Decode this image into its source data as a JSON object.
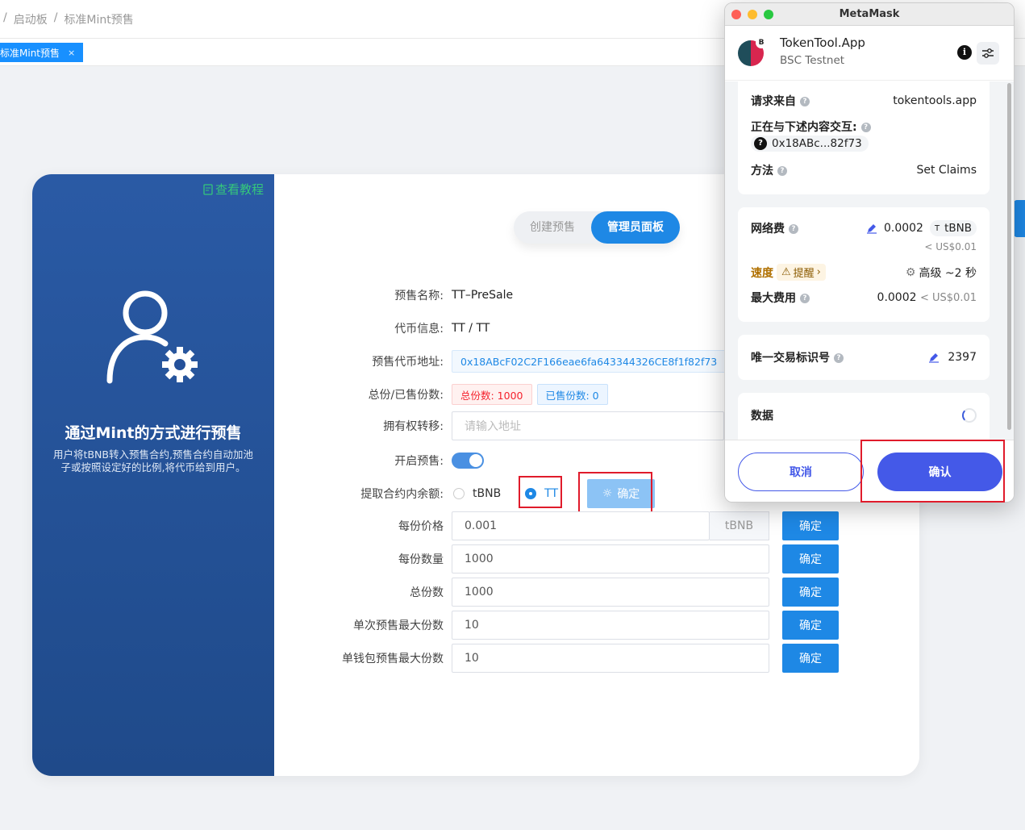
{
  "breadcrumb": {
    "sep1": "/",
    "item1": "启动板",
    "sep2": "/",
    "item2": "标准Mint预售"
  },
  "tabs": {
    "active_label": "标准Mint预售",
    "close": "×"
  },
  "left_panel": {
    "tutorial": "查看教程",
    "title": "通过Mint的方式进行预售",
    "desc": "用户将tBNB转入预售合约,预售合约自动加池子或按照设定好的比例,将代币给到用户。"
  },
  "segment": {
    "create": "创建预售",
    "admin": "管理员面板"
  },
  "form": {
    "presale_name": {
      "label": "预售名称:",
      "value": "TT–PreSale"
    },
    "token_info": {
      "label": "代币信息:",
      "value": "TT / TT"
    },
    "token_address": {
      "label": "预售代币地址:",
      "value": "0x18ABcF02C2F166eae6fa643344326CE8f1f82f73"
    },
    "shares": {
      "label": "总份/已售份数:",
      "total": "总份数: 1000",
      "sold": "已售份数: 0"
    },
    "ownership": {
      "label": "拥有权转移:",
      "placeholder": "请输入地址"
    },
    "open_presale": {
      "label": "开启预售:"
    },
    "withdraw": {
      "label": "提取合约内余额:",
      "opt1": "tBNB",
      "opt2": "TT",
      "button": "确定"
    },
    "price": {
      "label": "每份价格",
      "value": "0.001",
      "suffix": "tBNB",
      "button": "确定"
    },
    "qty": {
      "label": "每份数量",
      "value": "1000",
      "button": "确定"
    },
    "total": {
      "label": "总份数",
      "value": "1000",
      "button": "确定"
    },
    "max_single": {
      "label": "单次预售最大份数",
      "value": "10",
      "button": "确定"
    },
    "max_wallet": {
      "label": "单钱包预售最大份数",
      "value": "10",
      "button": "确定"
    }
  },
  "metamask": {
    "window_title": "MetaMask",
    "site_name": "TokenTool.App",
    "network": "BSC Testnet",
    "network_badge": "B",
    "request_from_label": "请求来自",
    "request_from_value": "tokentools.app",
    "interacting_label": "正在与下述内容交互:",
    "contract": "0x18ABc...82f73",
    "method_label": "方法",
    "method_value": "Set Claims",
    "fee_label": "网络费",
    "fee_value": "0.0002",
    "fee_token": "tBNB",
    "fee_usd": "< US$0.01",
    "speed_label": "速度",
    "speed_warning": "提醒",
    "speed_value": "高级 ~2 秒",
    "max_fee_label": "最大费用",
    "max_fee_value": "0.0002",
    "max_fee_usd": "< US$0.01",
    "nonce_label": "唯一交易标识号",
    "nonce_value": "2397",
    "data_label": "数据",
    "cancel": "取消",
    "confirm": "确认"
  },
  "colors": {
    "primary": "#1e88e5",
    "panel": "#254f96",
    "metamask_blue": "#4459e8",
    "highlight": "#e01b2b"
  }
}
